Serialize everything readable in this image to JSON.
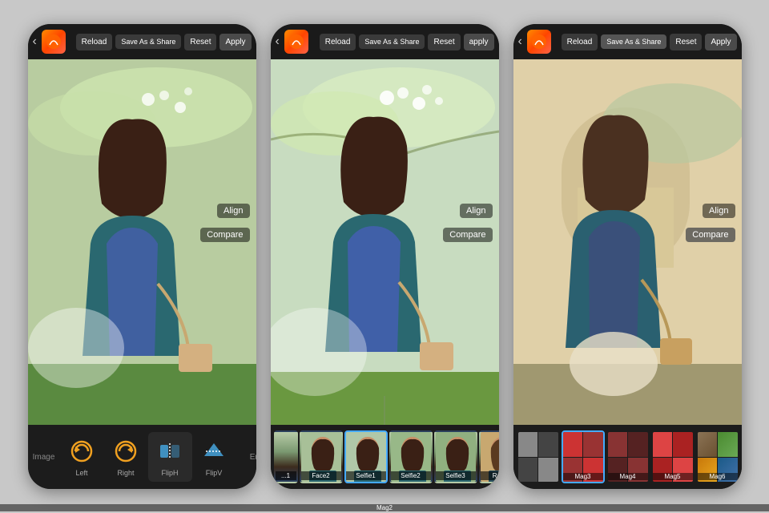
{
  "phones": [
    {
      "id": "phone-left",
      "toolbar": {
        "reload_label": "Reload",
        "save_label": "Save As\n& Share",
        "reset_label": "Reset",
        "apply_label": "Apply"
      },
      "overlay": {
        "align_label": "Align",
        "compare_label": "Compare"
      },
      "bottom": {
        "type": "image-tools",
        "label": "Image",
        "items": [
          {
            "id": "left",
            "label": "Left",
            "icon": "rotate-left"
          },
          {
            "id": "right",
            "label": "Right",
            "icon": "rotate-right"
          },
          {
            "id": "fliph",
            "label": "FlipH",
            "icon": "flip-h",
            "selected": true
          },
          {
            "id": "flipv",
            "label": "FlipV",
            "icon": "flip-v"
          }
        ],
        "more_label": "En..."
      }
    },
    {
      "id": "phone-middle",
      "toolbar": {
        "reload_label": "Reload",
        "save_label": "Save As\n& Share",
        "reset_label": "Reset",
        "apply_label": "apply"
      },
      "overlay": {
        "align_label": "Align",
        "compare_label": "Compare"
      },
      "bottom": {
        "type": "face-effects",
        "thumbs": [
          {
            "id": "face1",
            "label": "...1"
          },
          {
            "id": "face2",
            "label": "Face2"
          },
          {
            "id": "selfie1",
            "label": "Selfie1",
            "selected": true
          },
          {
            "id": "selfie2",
            "label": "Selfie2"
          },
          {
            "id": "selfie3",
            "label": "Selfie3"
          },
          {
            "id": "retro",
            "label": "Retro"
          }
        ]
      }
    },
    {
      "id": "phone-right",
      "toolbar": {
        "reload_label": "Reload",
        "save_label": "Save As\n& Share",
        "reset_label": "Reset",
        "apply_label": "Apply"
      },
      "overlay": {
        "align_label": "Align",
        "compare_label": "Compare"
      },
      "bottom": {
        "type": "mag-effects",
        "thumbs": [
          {
            "id": "mag2",
            "label": "Mag2",
            "colors": [
              "#cc3333",
              "#cc3333",
              "#cc3333",
              "#cc3333"
            ]
          },
          {
            "id": "mag3",
            "label": "Mag3",
            "selected": true,
            "colors": [
              "#cc3333",
              "#cc3333",
              "#cc3333",
              "#cc3333"
            ]
          },
          {
            "id": "mag4",
            "label": "Mag4",
            "colors": [
              "#7a3333",
              "#7a3333",
              "#7a3333",
              "#7a3333"
            ]
          },
          {
            "id": "mag5",
            "label": "Mag5",
            "colors": [
              "#cc4444",
              "#cc4444",
              "#cc4444",
              "#cc4444"
            ]
          },
          {
            "id": "mag6",
            "label": "Mag6",
            "colors": [
              "#8B7355",
              "#6aaa55",
              "#e8a820",
              "#4472aa"
            ]
          }
        ]
      }
    }
  ]
}
